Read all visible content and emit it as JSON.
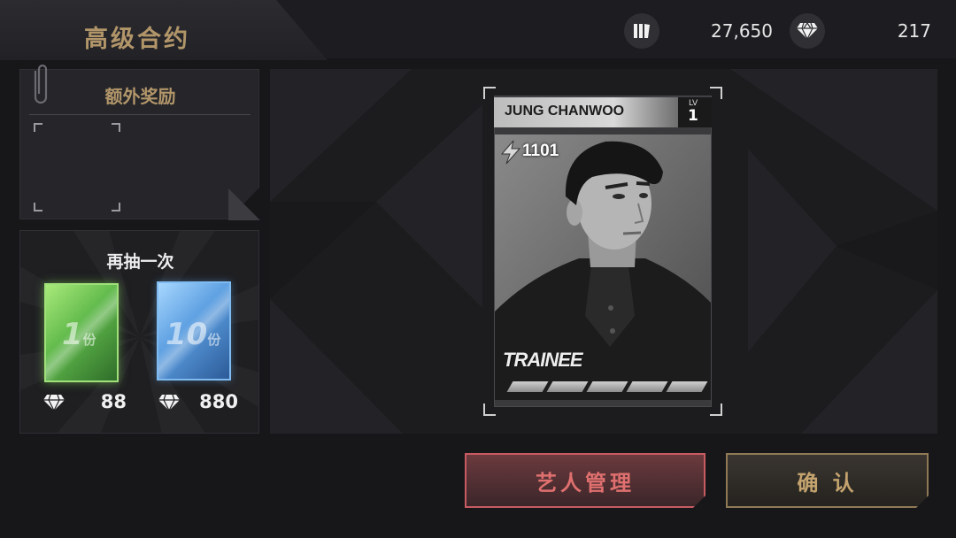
{
  "header": {
    "title": "高级合约",
    "icons": [
      "cards-icon",
      "diamond-icon"
    ],
    "card_count": "27,650",
    "diamond_count": "217"
  },
  "bonus": {
    "title": "额外奖励"
  },
  "redraw": {
    "title": "再抽一次",
    "options": [
      {
        "amount": "1",
        "unit": "份",
        "price": "88",
        "color": "#6fcf4a"
      },
      {
        "amount": "10",
        "unit": "份",
        "price": "880",
        "color": "#5b9ee8"
      }
    ]
  },
  "card": {
    "name": "JUNG CHANWOO",
    "lv_label": "LV",
    "level": "1",
    "power": "1101",
    "rank": "TRAINEE",
    "star_slots": 5
  },
  "buttons": {
    "artist_manage": "艺人管理",
    "confirm": "确 认"
  },
  "colors": {
    "gold": "#b2966a",
    "red_accent": "#c85a62"
  }
}
